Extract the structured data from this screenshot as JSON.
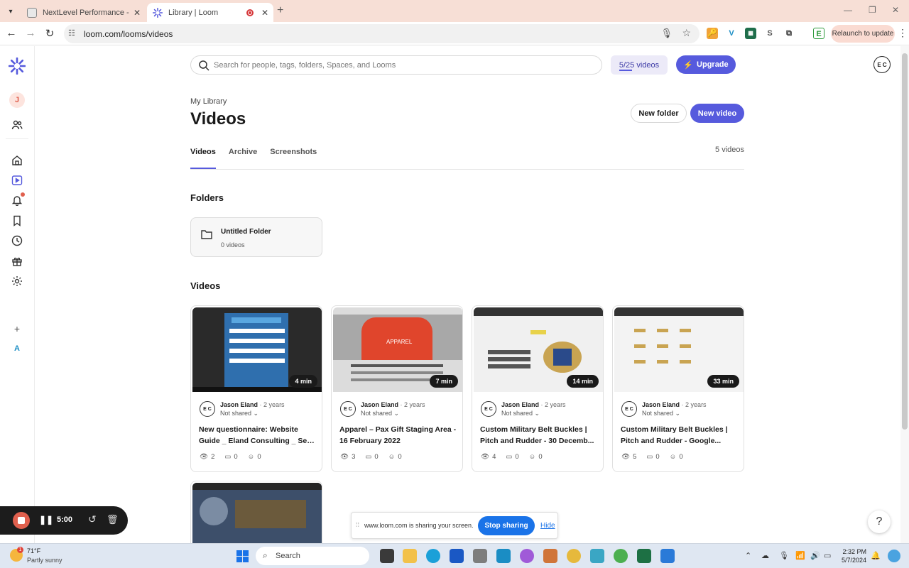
{
  "browser": {
    "tabs": [
      {
        "title": "NextLevel Performance - Produ",
        "active": false
      },
      {
        "title": "Library | Loom",
        "active": true
      }
    ],
    "url": "loom.com/looms/videos",
    "relaunch_label": "Relaunch to update"
  },
  "header": {
    "search_placeholder": "Search for people, tags, folders, Spaces, and Looms",
    "quota": "5/25 videos",
    "upgrade_label": "Upgrade",
    "profile_initials": "E C"
  },
  "sidebar": {
    "workspace_initial": "J",
    "space_initial": "A"
  },
  "page": {
    "breadcrumb": "My Library",
    "title": "Videos",
    "new_folder_label": "New folder",
    "new_video_label": "New video",
    "tabs": [
      "Videos",
      "Archive",
      "Screenshots"
    ],
    "count": "5 videos",
    "folders_heading": "Folders",
    "videos_heading": "Videos"
  },
  "folders": [
    {
      "name": "Untitled Folder",
      "count": "0 videos"
    }
  ],
  "videos": [
    {
      "duration": "4 min",
      "author": "Jason Eland",
      "age": "2 years",
      "sharing": "Not shared",
      "title_line1": "New questionnaire: Website",
      "title_line2": "Guide _ Eland Consulting _ Seo ...",
      "views": "2",
      "comments": "0",
      "reactions": "0"
    },
    {
      "duration": "7 min",
      "author": "Jason Eland",
      "age": "2 years",
      "sharing": "Not shared",
      "title_line1": "Apparel – Pax Gift Staging Area -",
      "title_line2": "16 February 2022",
      "views": "3",
      "comments": "0",
      "reactions": "0"
    },
    {
      "duration": "14 min",
      "author": "Jason Eland",
      "age": "2 years",
      "sharing": "Not shared",
      "title_line1": "Custom Military Belt Buckles |",
      "title_line2": "Pitch and Rudder - 30 Decemb...",
      "views": "4",
      "comments": "0",
      "reactions": "0"
    },
    {
      "duration": "33 min",
      "author": "Jason Eland",
      "age": "2 years",
      "sharing": "Not shared",
      "title_line1": "Custom Military Belt Buckles |",
      "title_line2": "Pitch and Rudder - Google...",
      "views": "5",
      "comments": "0",
      "reactions": "0"
    }
  ],
  "avatar_initials": "E C",
  "recorder": {
    "time": "5:00"
  },
  "share_banner": {
    "message": "www.loom.com is sharing your screen.",
    "stop_label": "Stop sharing",
    "hide_label": "Hide"
  },
  "help_label": "?",
  "taskbar": {
    "weather_temp": "71°F",
    "weather_desc": "Partly sunny",
    "weather_badge": "1",
    "search_label": "Search",
    "time": "2:32 PM",
    "date": "5/7/2024"
  },
  "colors": {
    "accent": "#565add",
    "record": "#e0604e",
    "share_blue": "#1a73e8"
  }
}
